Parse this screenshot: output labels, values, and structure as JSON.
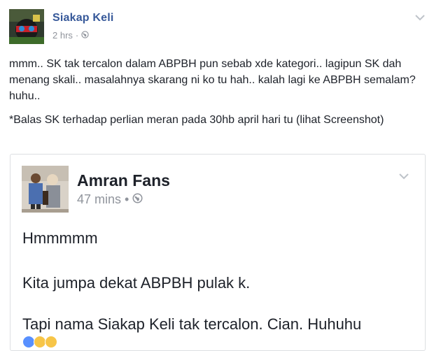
{
  "post": {
    "author": "Siakap Keli",
    "time": "2 hrs",
    "separator": "·",
    "paragraph1": "mmm.. SK tak tercalon dalam ABPBH pun sebab xde kategori.. lagipun SK dah menang skali.. masalahnya skarang ni ko tu hah.. kalah lagi ke ABPBH semalam? huhu..",
    "paragraph2": "*Balas SK terhadap perlian meran pada 30hb april hari tu (lihat Screenshot)"
  },
  "shared_post": {
    "author": "Amran Fans",
    "time": "47 mins",
    "separator": "•",
    "line1": "Hmmmmm",
    "line2": "Kita jumpa dekat ABPBH pulak k.",
    "line3": "Tapi nama Siakap Keli tak tercalon. Cian.  Huhuhu"
  },
  "icons": {
    "privacy": "globe-icon",
    "options": "chevron-down-icon"
  },
  "colors": {
    "author_link": "#365899",
    "meta_text": "#90949c",
    "body_text": "#1d2129",
    "card_border": "#dddfe2"
  }
}
